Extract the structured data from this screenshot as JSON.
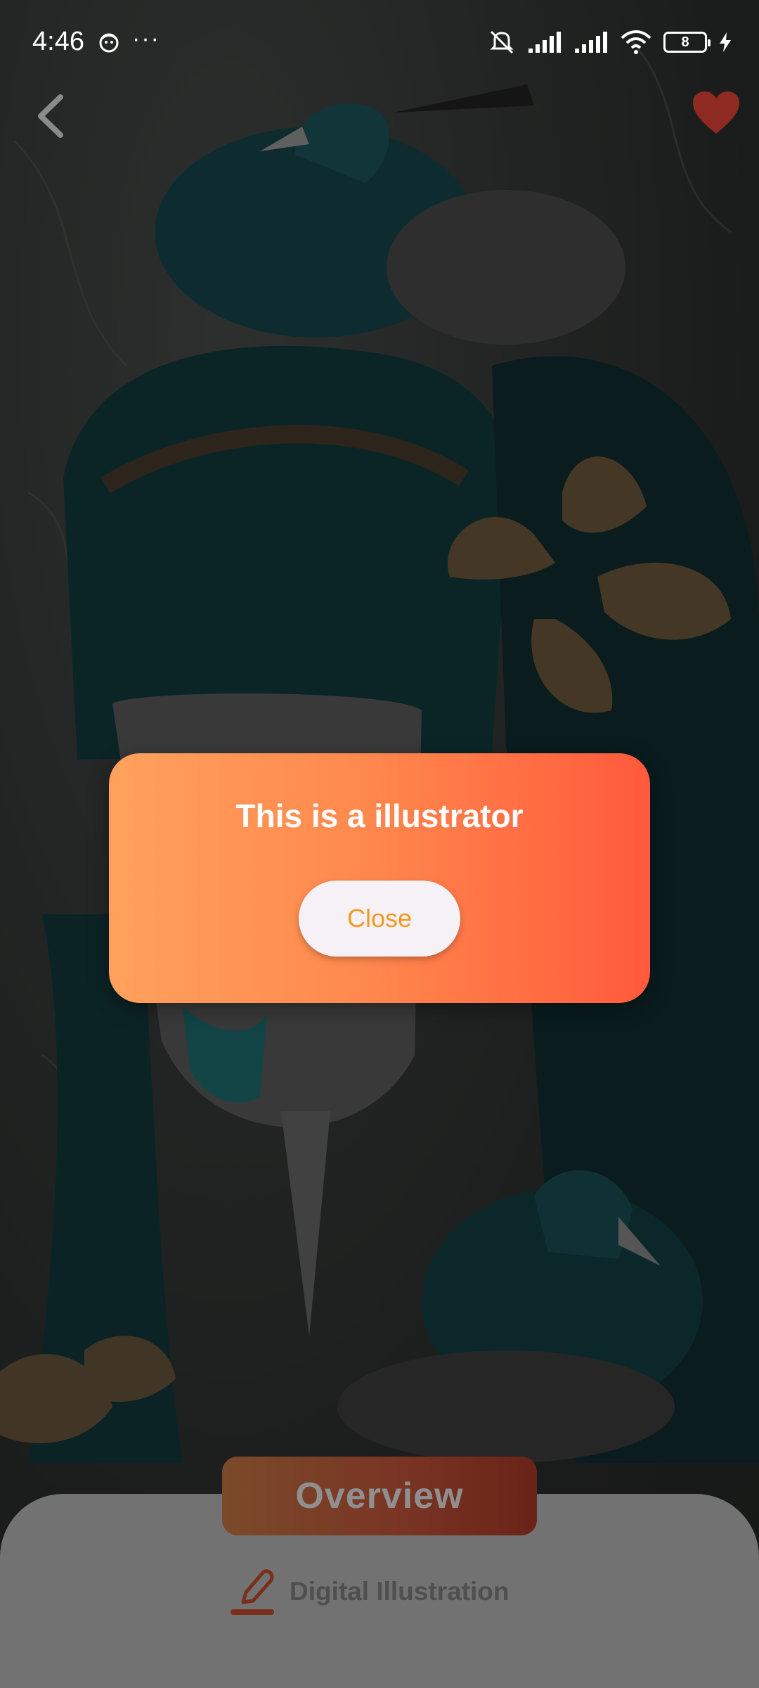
{
  "status_bar": {
    "time": "4:46",
    "more": "···",
    "battery": "8",
    "icons": [
      "face-icon",
      "mute-icon",
      "signal-icon",
      "signal-icon",
      "wifi-icon",
      "battery-icon",
      "charging-icon"
    ]
  },
  "header": {
    "back_icon": "chevron-left-icon",
    "favorite_icon": "heart-icon",
    "favorite_color": "#8f2a22"
  },
  "dialog": {
    "title": "This is a illustrator",
    "close_label": "Close",
    "gradient": [
      "#ffa15c",
      "#ff5a3c"
    ],
    "close_text_color": "#f29a1c"
  },
  "bottom_sheet": {
    "overview_label": "Overview",
    "category_icon": "pencil-icon",
    "category_label": "Digital Illustration"
  }
}
